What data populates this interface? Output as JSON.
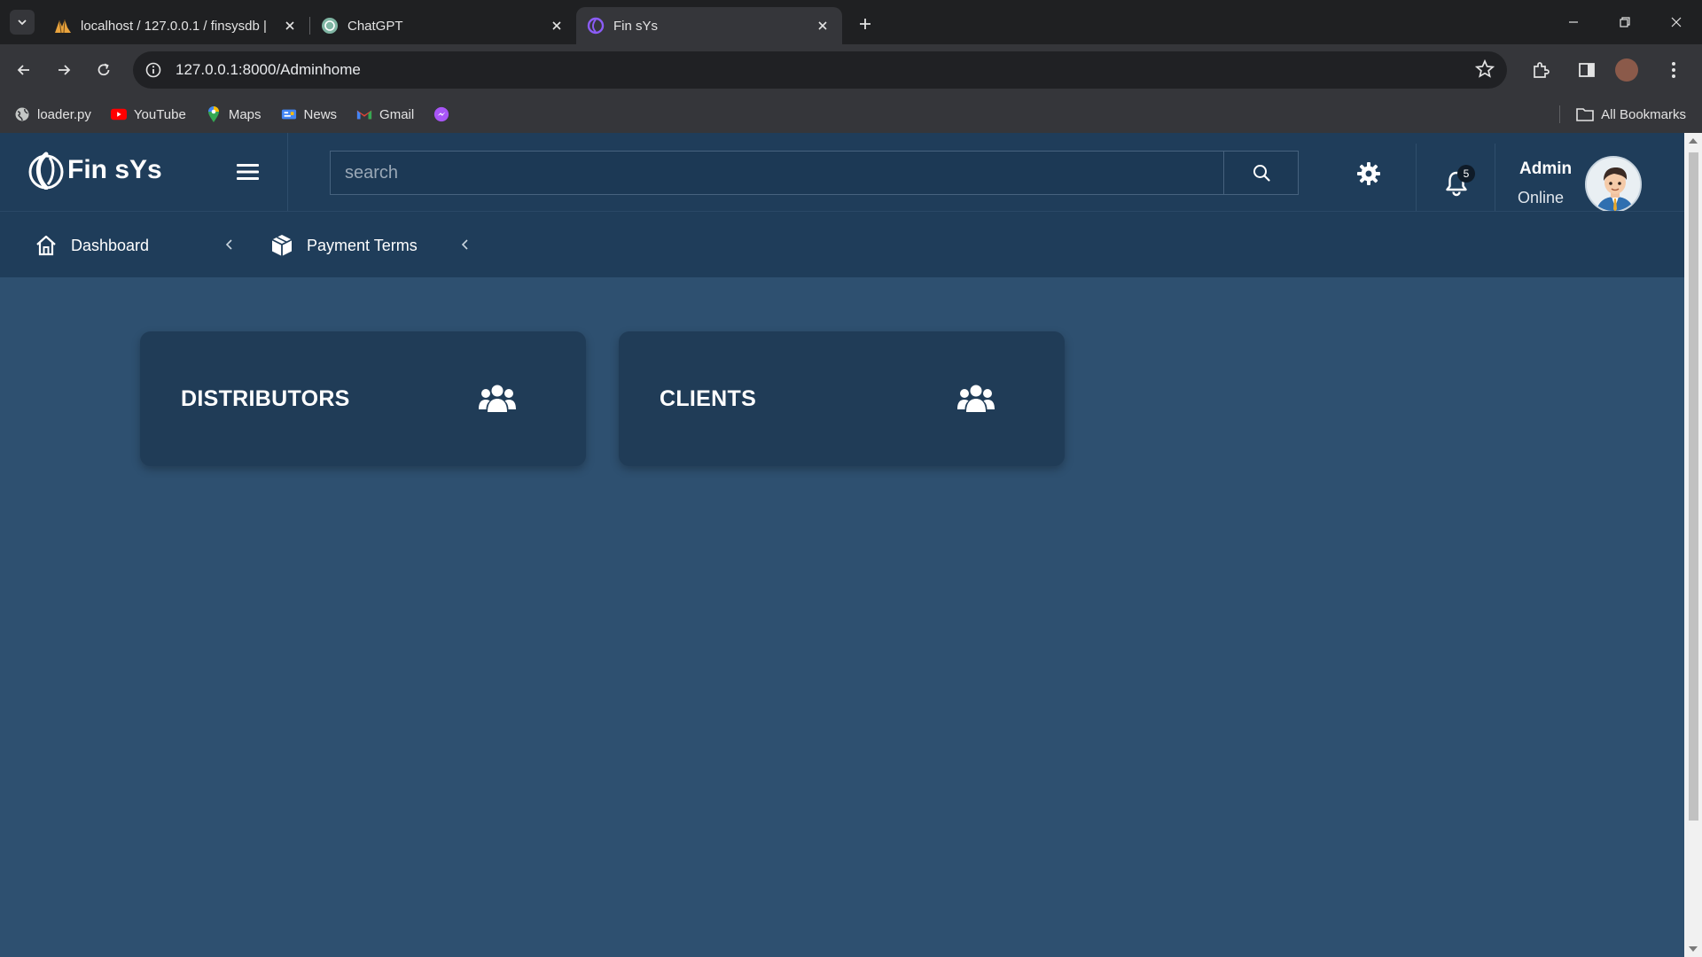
{
  "browser": {
    "tabs": [
      {
        "title": "localhost / 127.0.0.1 / finsysdb |",
        "favicon": "phpmyadmin-icon",
        "active": false
      },
      {
        "title": "ChatGPT",
        "favicon": "chatgpt-icon",
        "active": false
      },
      {
        "title": "Fin sYs",
        "favicon": "finsys-icon",
        "active": true
      }
    ],
    "url": "127.0.0.1:8000/Adminhome",
    "bookmarks": [
      {
        "label": "loader.py",
        "icon": "globe-icon"
      },
      {
        "label": "YouTube",
        "icon": "youtube-icon"
      },
      {
        "label": "Maps",
        "icon": "maps-icon"
      },
      {
        "label": "News",
        "icon": "news-icon"
      },
      {
        "label": "Gmail",
        "icon": "gmail-icon"
      },
      {
        "label": "",
        "icon": "messenger-icon"
      }
    ],
    "all_bookmarks_label": "All Bookmarks"
  },
  "app": {
    "brand": "Fin sYs",
    "search_placeholder": "search",
    "notifications_count": "5",
    "user_name": "Admin",
    "user_status": "Online",
    "breadcrumb": [
      {
        "label": "Dashboard",
        "icon": "home-icon"
      },
      {
        "label": "Payment Terms",
        "icon": "box-icon"
      }
    ],
    "cards": [
      {
        "label": "DISTRIBUTORS",
        "icon": "users-icon"
      },
      {
        "label": "CLIENTS",
        "icon": "users-icon"
      }
    ]
  },
  "colors": {
    "page_bg": "#2e5070",
    "nav_bg": "#1f3d5a",
    "card_bg": "#203c57"
  }
}
